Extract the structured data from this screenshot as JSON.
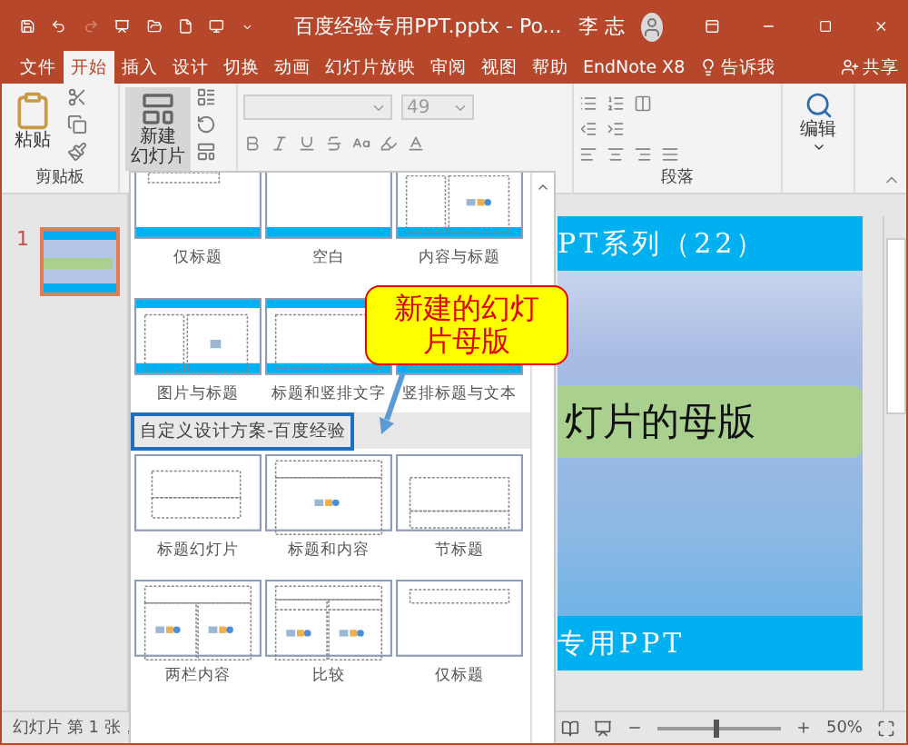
{
  "window": {
    "title": "百度经验专用PPT.pptx  -  Po...",
    "user": "李 志"
  },
  "tabs": [
    {
      "label": "文件",
      "selected": false
    },
    {
      "label": "开始",
      "selected": true
    },
    {
      "label": "插入",
      "selected": false
    },
    {
      "label": "设计",
      "selected": false
    },
    {
      "label": "切换",
      "selected": false
    },
    {
      "label": "动画",
      "selected": false
    },
    {
      "label": "幻灯片放映",
      "selected": false
    },
    {
      "label": "审阅",
      "selected": false
    },
    {
      "label": "视图",
      "selected": false
    },
    {
      "label": "帮助",
      "selected": false
    },
    {
      "label": "EndNote X8",
      "selected": false
    }
  ],
  "tell_me": "告诉我",
  "share": "共享",
  "ribbon": {
    "paste": "粘贴",
    "new_slide": [
      "新建",
      "幻灯片"
    ],
    "font_size": "49",
    "editing": "编辑",
    "clipboard_group": "剪贴板",
    "paragraph_group": "段落"
  },
  "slides": [
    {
      "number": "1",
      "selected": true
    }
  ],
  "gallery": {
    "top_items": [
      {
        "label": "仅标题",
        "kind": "title-only-banded"
      },
      {
        "label": "空白",
        "kind": "blank-banded"
      },
      {
        "label": "内容与标题",
        "kind": "content-caption"
      },
      {
        "label": "图片与标题",
        "kind": "picture-caption"
      },
      {
        "label": "标题和竖排文字",
        "kind": "vertical-text"
      },
      {
        "label": "竖排标题与文本",
        "kind": "vertical-title"
      }
    ],
    "section_title": "自定义设计方案-百度经验",
    "section_items": [
      {
        "label": "标题幻灯片",
        "kind": "title-slide"
      },
      {
        "label": "标题和内容",
        "kind": "title-content"
      },
      {
        "label": "节标题",
        "kind": "section-header"
      },
      {
        "label": "两栏内容",
        "kind": "two-content"
      },
      {
        "label": "比较",
        "kind": "comparison"
      },
      {
        "label": "仅标题",
        "kind": "title-only"
      }
    ]
  },
  "callout": [
    "新建的幻灯",
    "片母版"
  ],
  "slide": {
    "header": "PT系列（22）",
    "title": "灯片的母版",
    "footer": "专用PPT"
  },
  "status_bar": {
    "text": "幻灯片 第 1 张，",
    "zoom": "50%",
    "zoom_slider": {
      "level": 0.45
    }
  }
}
